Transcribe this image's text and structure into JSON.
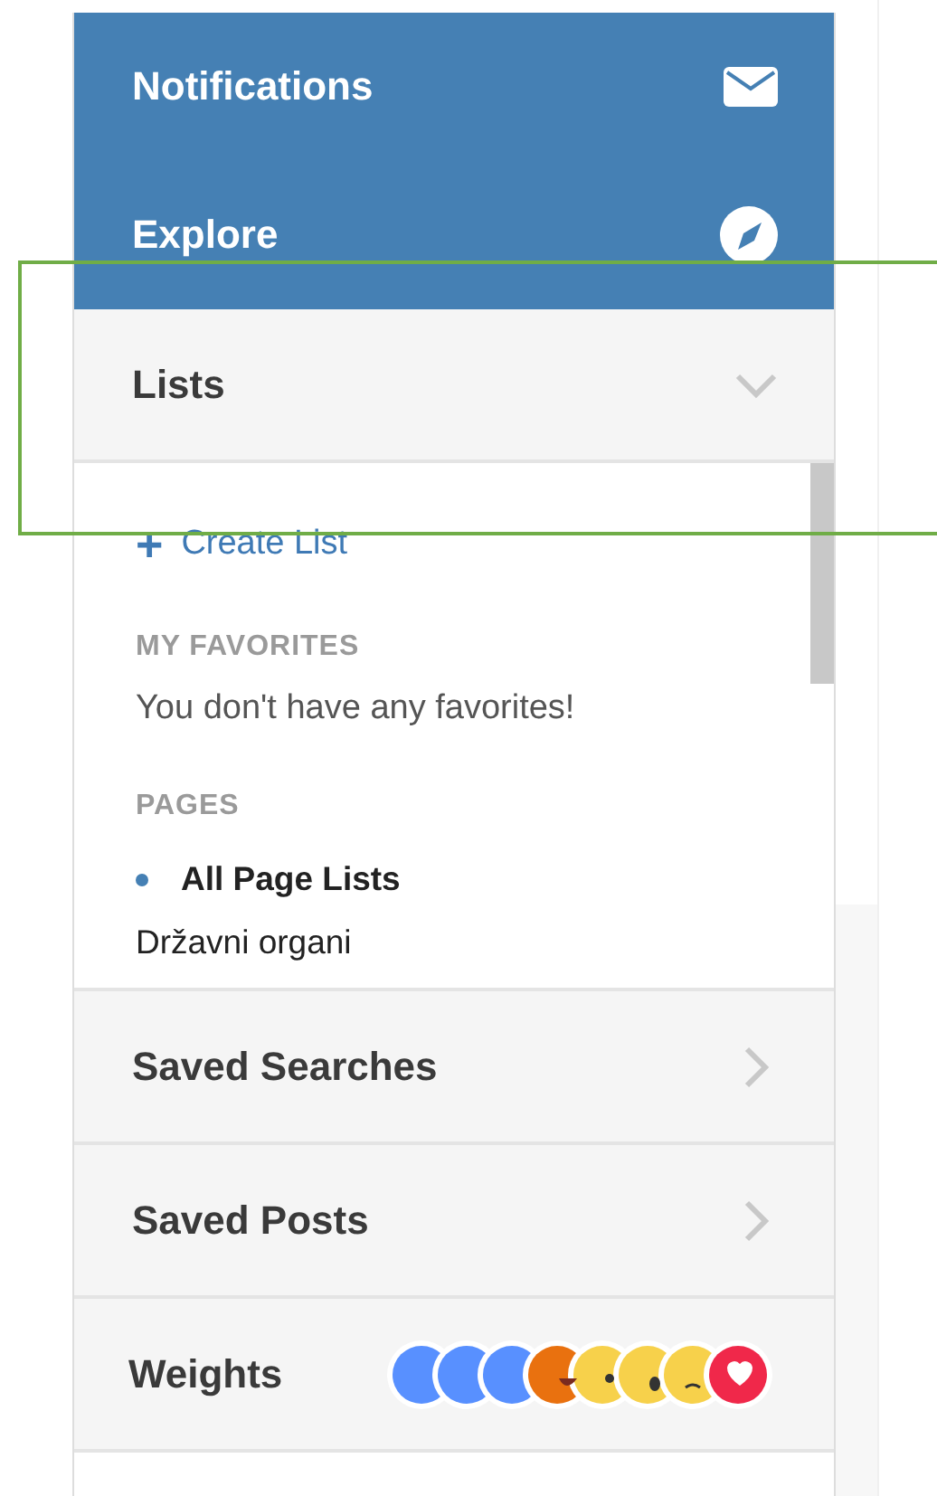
{
  "sidebar": {
    "items": [
      {
        "kind": "primary",
        "label": "Notifications"
      },
      {
        "kind": "primary",
        "label": "Explore"
      },
      {
        "kind": "section",
        "label": "Lists",
        "expanded": true
      },
      {
        "kind": "section",
        "label": "Saved Searches",
        "expanded": false
      },
      {
        "kind": "section",
        "label": "Saved Posts",
        "expanded": false
      },
      {
        "kind": "weights",
        "label": "Weights"
      }
    ]
  },
  "lists": {
    "create_list": {
      "icon": "+",
      "label": "Create List"
    },
    "groups": [
      {
        "heading": "MY FAVORITES",
        "empty_text": "You don't have any favorites!"
      },
      {
        "heading": "PAGES",
        "items": [
          {
            "label": "All Page Lists",
            "selected": true
          },
          {
            "label": "Državni organi",
            "selected": false
          }
        ]
      }
    ]
  }
}
